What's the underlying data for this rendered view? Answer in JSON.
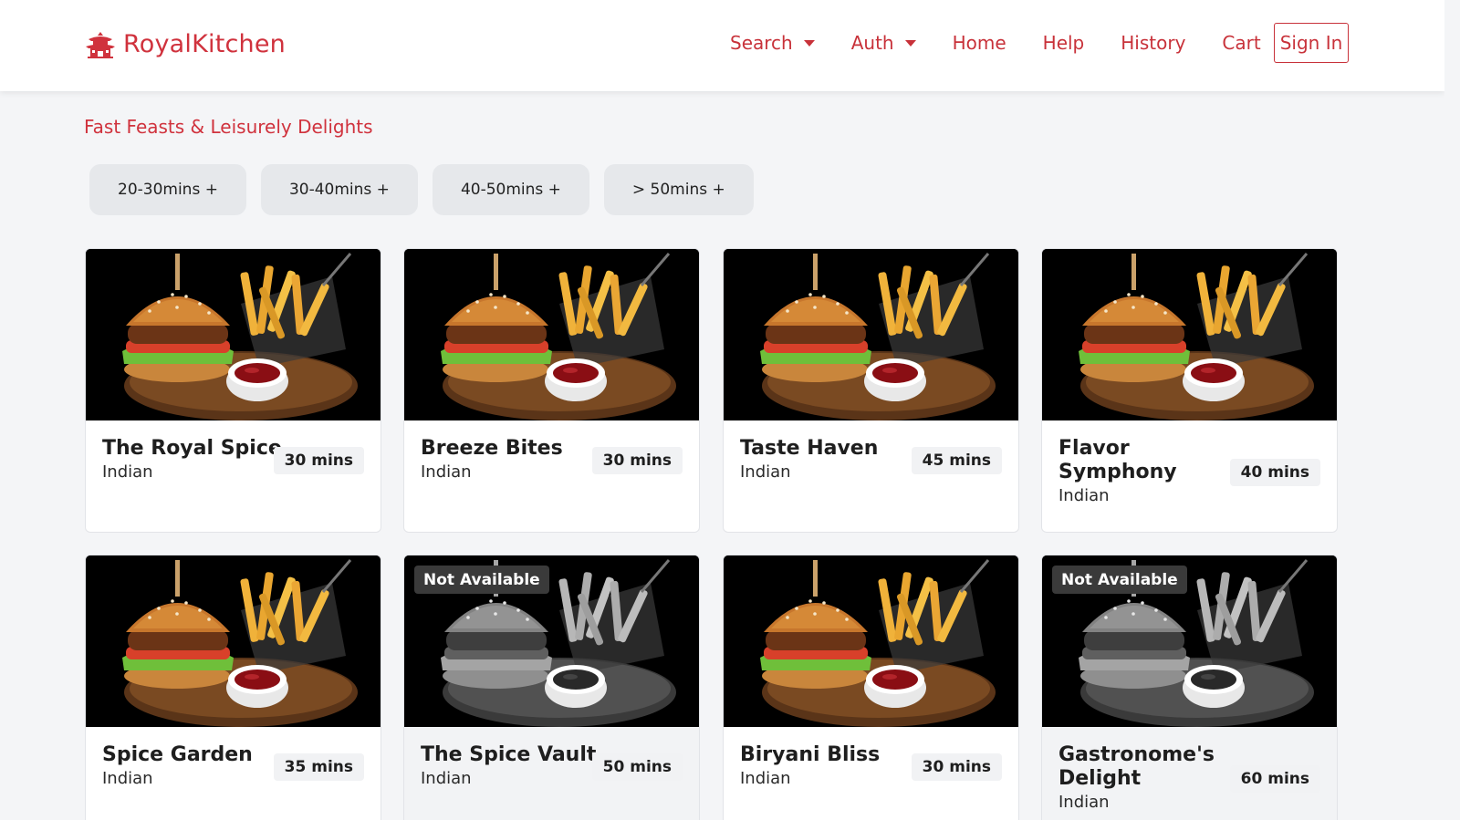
{
  "navbar": {
    "brand": "RoyalKitchen",
    "brand_icon": "palace-icon",
    "items": [
      {
        "label": "Search",
        "dropdown": true
      },
      {
        "label": "Auth",
        "dropdown": true
      },
      {
        "label": "Home",
        "dropdown": false
      },
      {
        "label": "Help",
        "dropdown": false
      },
      {
        "label": "History",
        "dropdown": false
      },
      {
        "label": "Cart",
        "dropdown": false
      }
    ],
    "sign_in": "Sign In"
  },
  "section_title": "Fast Feasts & Leisurely Delights",
  "filters": [
    "20-30mins +",
    "30-40mins +",
    "40-50mins +",
    "> 50mins +"
  ],
  "restaurants": [
    {
      "name": "The Royal Spice",
      "cuisine": "Indian",
      "time": "30 mins",
      "available": true
    },
    {
      "name": "Breeze Bites",
      "cuisine": "Indian",
      "time": "30 mins",
      "available": true
    },
    {
      "name": "Taste Haven",
      "cuisine": "Indian",
      "time": "45 mins",
      "available": true
    },
    {
      "name": "Flavor Symphony",
      "cuisine": "Indian",
      "time": "40 mins",
      "available": true
    },
    {
      "name": "Spice Garden",
      "cuisine": "Indian",
      "time": "35 mins",
      "available": true
    },
    {
      "name": "The Spice Vault",
      "cuisine": "Indian",
      "time": "50 mins",
      "available": false
    },
    {
      "name": "Biryani Bliss",
      "cuisine": "Indian",
      "time": "30 mins",
      "available": true
    },
    {
      "name": "Gastronome's Delight",
      "cuisine": "Indian",
      "time": "60 mins",
      "available": false
    }
  ],
  "not_available_label": "Not Available",
  "colors": {
    "accent": "#c8323a",
    "background": "#f4f5f7"
  }
}
